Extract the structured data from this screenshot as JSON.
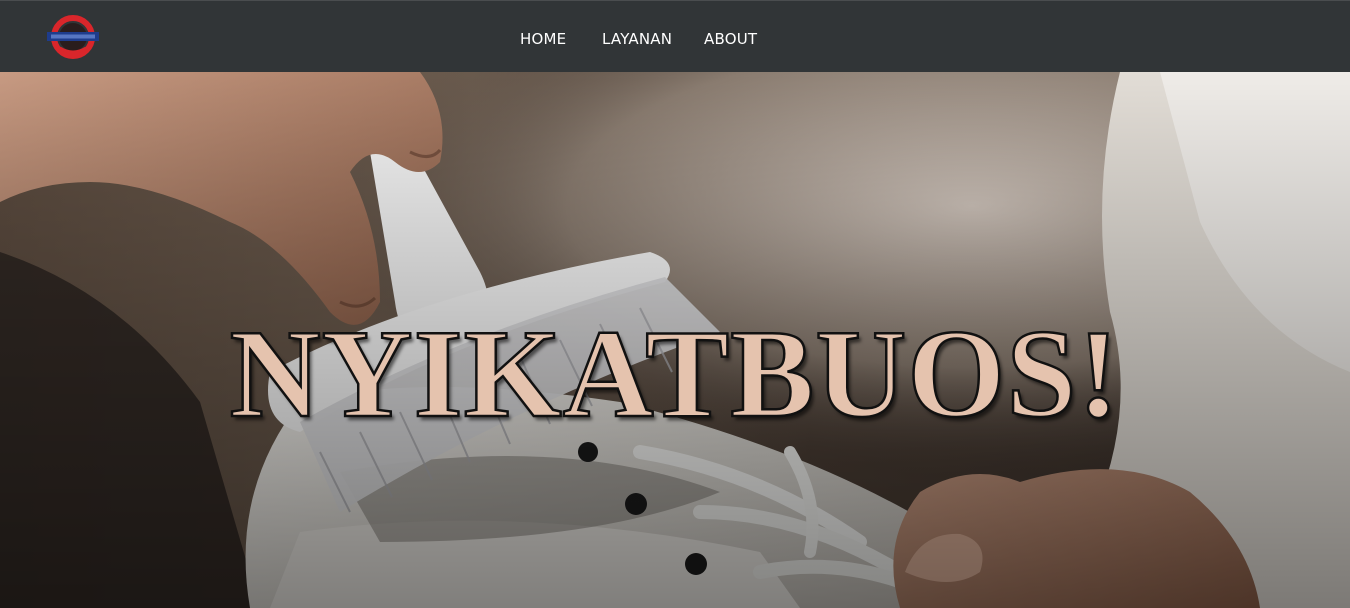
{
  "navbar": {
    "logo_icon": "brand-logo-icon",
    "links": [
      {
        "label": "HOME"
      },
      {
        "label": "LAYANAN"
      },
      {
        "label": "ABOUT"
      }
    ]
  },
  "hero": {
    "title": "NYIKATBUOS!",
    "background_image": "hands-brushing-white-sneaker-photo"
  },
  "colors": {
    "navbar_bg": "#313537",
    "title_fill": "#e5c3ae",
    "title_stroke": "#111111",
    "logo_red": "#d9262b",
    "logo_blue": "#1e3c8c"
  }
}
